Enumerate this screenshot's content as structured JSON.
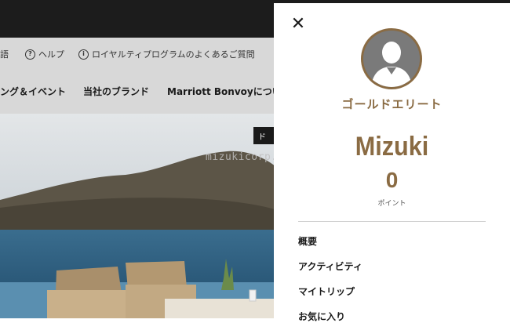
{
  "utility_nav": {
    "language_fragment": "語",
    "help": "ヘルプ",
    "faq": "ロイヤルティプログラムのよくあるご質問"
  },
  "main_nav": {
    "item_partial": "ング＆イベント",
    "brands": "当社のブランド",
    "about_partial": "Marriott Bonvoyについ"
  },
  "hero": {
    "badge_fragment": "ド"
  },
  "watermark": "mizukicorp.com",
  "panel": {
    "close_glyph": "✕",
    "tier": "ゴールドエリート",
    "member_name": "Mizuki",
    "points": "0",
    "points_label": "ポイント",
    "menu": [
      {
        "label": "概要"
      },
      {
        "label": "アクティビティ"
      },
      {
        "label": "マイトリップ"
      },
      {
        "label": "お気に入り"
      }
    ]
  },
  "colors": {
    "accent_gold": "#8a6b43",
    "top_bar": "#1c1c1c",
    "overlay_gray": "#d8d8d8"
  }
}
